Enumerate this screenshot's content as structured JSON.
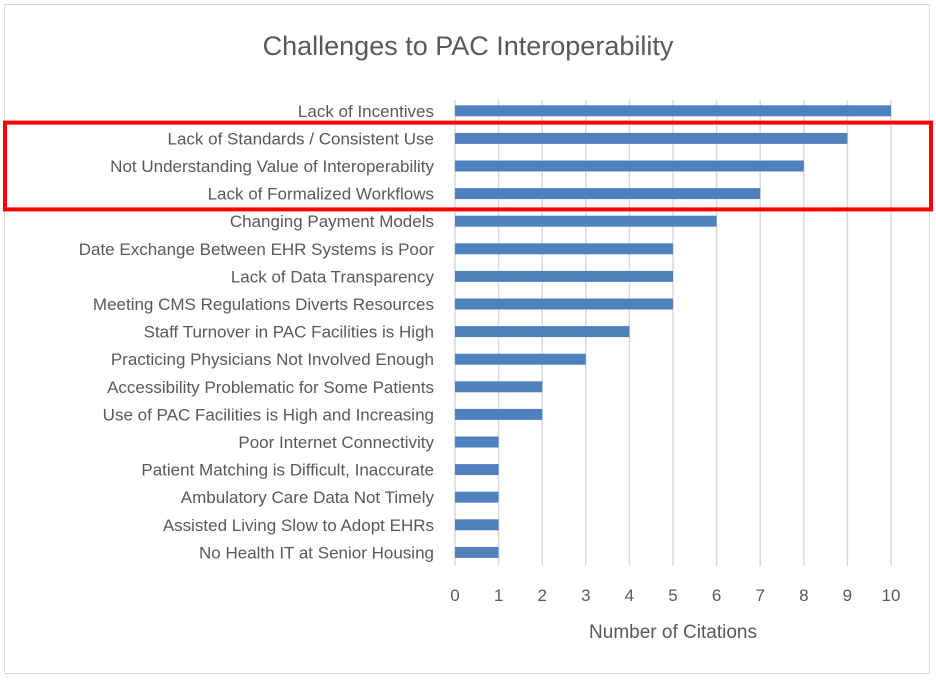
{
  "chart_data": {
    "type": "bar",
    "orientation": "horizontal",
    "title": "Challenges to PAC Interoperability",
    "xlabel": "Number of Citations",
    "ylabel": "",
    "xlim": [
      0,
      10
    ],
    "xticks": [
      0,
      1,
      2,
      3,
      4,
      5,
      6,
      7,
      8,
      9,
      10
    ],
    "grid": "vertical",
    "legend": "none",
    "bar_color": "#4f81bd",
    "categories": [
      "Lack of Incentives",
      "Lack of Standards / Consistent Use",
      "Not Understanding Value of Interoperability",
      "Lack of Formalized Workflows",
      "Changing Payment Models",
      "Date Exchange Between EHR Systems is Poor",
      "Lack of Data Transparency",
      "Meeting CMS Regulations Diverts Resources",
      "Staff Turnover in PAC Facilities is High",
      "Practicing Physicians Not Involved Enough",
      "Accessibility Problematic for Some Patients",
      "Use of PAC Facilities is High and Increasing",
      "Poor Internet Connectivity",
      "Patient Matching is Difficult, Inaccurate",
      "Ambulatory Care Data Not Timely",
      "Assisted Living Slow to Adopt EHRs",
      "No Health IT at Senior Housing"
    ],
    "values": [
      10,
      9,
      8,
      7,
      6,
      5,
      5,
      5,
      4,
      3,
      2,
      2,
      1,
      1,
      1,
      1,
      1
    ],
    "annotations": [
      {
        "type": "highlight-box",
        "color": "#ff0000",
        "categories": [
          "Lack of Standards / Consistent Use",
          "Not Understanding Value of Interoperability",
          "Lack of Formalized Workflows"
        ]
      }
    ]
  }
}
